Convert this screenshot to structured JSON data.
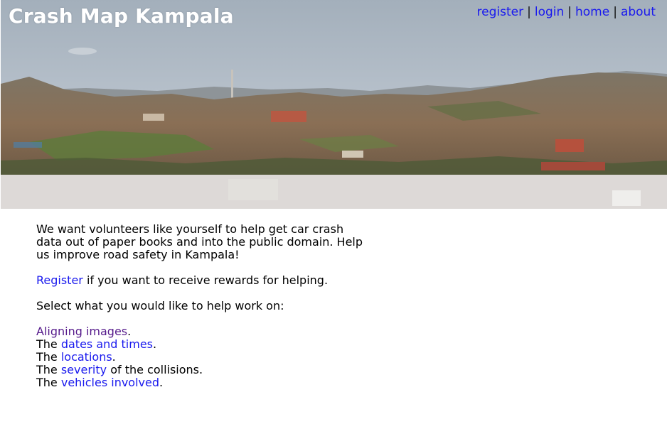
{
  "header": {
    "title": "Crash Map Kampala",
    "nav": [
      "register",
      "login",
      "home",
      "about"
    ],
    "separator": "|"
  },
  "main": {
    "intro": "We want volunteers like yourself to help get car crash data out of paper books and into the public domain. Help us improve road safety in Kampala!",
    "register_link": "Register",
    "register_rest": " if you want to receive rewards for helping.",
    "select_prompt": "Select what you would like to help work on:",
    "tasks": [
      {
        "prefix": "",
        "link": "Aligning images",
        "suffix": "."
      },
      {
        "prefix": "The ",
        "link": "dates and times",
        "suffix": "."
      },
      {
        "prefix": "The ",
        "link": "locations",
        "suffix": "."
      },
      {
        "prefix": "The ",
        "link": "severity",
        "suffix": " of the collisions."
      },
      {
        "prefix": "The ",
        "link": "vehicles involved",
        "suffix": "."
      }
    ]
  },
  "colors": {
    "link": "#1a1aee",
    "visited_link": "#551a8b",
    "title": "#ffffff"
  }
}
